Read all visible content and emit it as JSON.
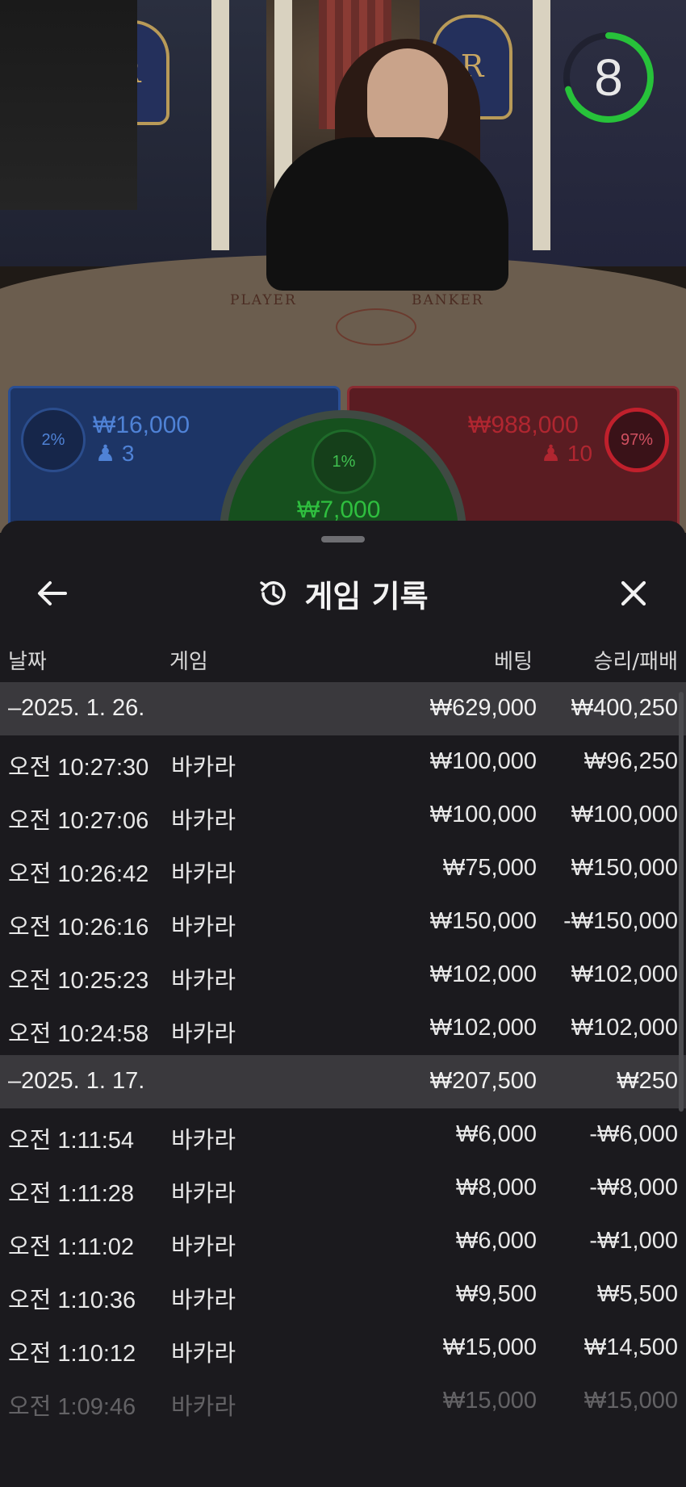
{
  "video": {
    "timer": "8",
    "felt_player": "PLAYER",
    "felt_banker": "BANKER",
    "crest_letter": "R"
  },
  "bets": {
    "player": {
      "percent": "2%",
      "amount": "₩16,000",
      "count": "3"
    },
    "tie": {
      "percent": "1%",
      "amount": "₩7,000"
    },
    "banker": {
      "percent": "97%",
      "amount": "₩988,000",
      "count": "10"
    }
  },
  "sheet": {
    "title": "게임 기록",
    "columns": {
      "date": "날짜",
      "game": "게임",
      "bet": "베팅",
      "result": "승리/패배"
    },
    "groups": [
      {
        "date": "–2025. 1. 26.",
        "bet": "₩629,000",
        "result": "₩400,250",
        "rows": [
          {
            "time": "오전 10:27:30",
            "game": "바카라",
            "bet": "₩100,000",
            "result": "₩96,250"
          },
          {
            "time": "오전 10:27:06",
            "game": "바카라",
            "bet": "₩100,000",
            "result": "₩100,000"
          },
          {
            "time": "오전 10:26:42",
            "game": "바카라",
            "bet": "₩75,000",
            "result": "₩150,000"
          },
          {
            "time": "오전 10:26:16",
            "game": "바카라",
            "bet": "₩150,000",
            "result": "-₩150,000"
          },
          {
            "time": "오전 10:25:23",
            "game": "바카라",
            "bet": "₩102,000",
            "result": "₩102,000"
          },
          {
            "time": "오전 10:24:58",
            "game": "바카라",
            "bet": "₩102,000",
            "result": "₩102,000"
          }
        ]
      },
      {
        "date": "–2025. 1. 17.",
        "bet": "₩207,500",
        "result": "₩250",
        "rows": [
          {
            "time": "오전 1:11:54",
            "game": "바카라",
            "bet": "₩6,000",
            "result": "-₩6,000"
          },
          {
            "time": "오전 1:11:28",
            "game": "바카라",
            "bet": "₩8,000",
            "result": "-₩8,000"
          },
          {
            "time": "오전 1:11:02",
            "game": "바카라",
            "bet": "₩6,000",
            "result": "-₩1,000"
          },
          {
            "time": "오전 1:10:36",
            "game": "바카라",
            "bet": "₩9,500",
            "result": "₩5,500"
          },
          {
            "time": "오전 1:10:12",
            "game": "바카라",
            "bet": "₩15,000",
            "result": "₩14,500"
          },
          {
            "time": "오전 1:09:46",
            "game": "바카라",
            "bet": "₩15,000",
            "result": "₩15,000"
          }
        ]
      }
    ]
  },
  "colors": {
    "player": "#2a4f94",
    "banker": "#c0202c",
    "tie": "#2fbf3f",
    "timer": "#27c23a"
  },
  "icons": {
    "back": "arrow-left-icon",
    "history": "history-icon",
    "close": "close-icon",
    "person": "person-icon"
  }
}
